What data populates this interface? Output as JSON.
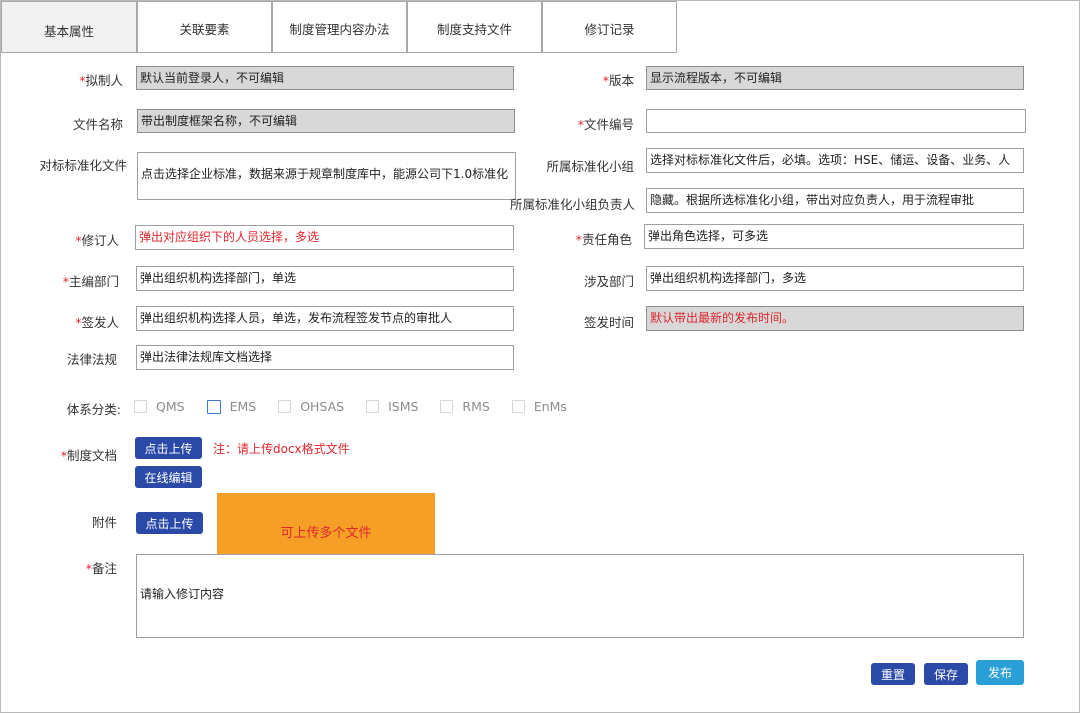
{
  "tabs": [
    {
      "label": "基本属性",
      "active": true
    },
    {
      "label": "关联要素"
    },
    {
      "label": "制度管理内容办法"
    },
    {
      "label": "制度支持文件"
    },
    {
      "label": "修订记录"
    }
  ],
  "required_mark": "*",
  "fields": {
    "drafter": {
      "label": "拟制人",
      "value": "默认当前登录人，不可编辑"
    },
    "version": {
      "label": "版本",
      "value": "显示流程版本，不可编辑"
    },
    "file_name": {
      "label": "文件名称",
      "value": "带出制度框架名称，不可编辑"
    },
    "file_number": {
      "label": "文件编号",
      "value": ""
    },
    "benchmark_file": {
      "label": "对标标准化文件",
      "value": "点击选择企业标准，数据来源于规章制度库中，能源公司下1.0标准化"
    },
    "std_group": {
      "label": "所属标准化小组",
      "value": "选择对标标准化文件后，必填。选项：HSE、储运、设备、业务、人"
    },
    "std_group_owner": {
      "label": "所属标准化小组负责人",
      "value": "隐藏。根据所选标准化小组，带出对应负责人，用于流程审批"
    },
    "reviser": {
      "label": "修订人",
      "value": "弹出对应组织下的人员选择，多选"
    },
    "resp_role": {
      "label": "责任角色",
      "value": "弹出角色选择，可多选"
    },
    "main_dept": {
      "label": "主编部门",
      "value": "弹出组织机构选择部门，单选"
    },
    "related_dept": {
      "label": "涉及部门",
      "value": "弹出组织机构选择部门，多选"
    },
    "issuer": {
      "label": "签发人",
      "value": "弹出组织机构选择人员，单选，发布流程签发节点的审批人"
    },
    "issue_time": {
      "label": "签发时间",
      "value": "默认带出最新的发布时间。"
    },
    "law": {
      "label": "法律法规",
      "value": "弹出法律法规库文档选择"
    }
  },
  "system": {
    "label": "体系分类:",
    "options": [
      {
        "label": "QMS",
        "checked": false
      },
      {
        "label": "EMS",
        "checked": false
      },
      {
        "label": "OHSAS",
        "checked": false
      },
      {
        "label": "ISMS",
        "checked": false
      },
      {
        "label": "RMS",
        "checked": false
      },
      {
        "label": "EnMs",
        "checked": false
      }
    ]
  },
  "doc": {
    "label": "制度文档",
    "upload_label": "点击上传",
    "note": "注：请上传docx格式文件",
    "edit_label": "在线编辑"
  },
  "attachment": {
    "label": "附件",
    "upload_label": "点击上传",
    "hint": "可上传多个文件"
  },
  "remark": {
    "label": "备注",
    "placeholder": "请输入修订内容"
  },
  "footer": {
    "reset_label": "重置",
    "save_label": "保存",
    "publish_label": "发布"
  },
  "colors": {
    "required": "#e0262e",
    "primary_button": "#2b4aa8",
    "publish_button": "#2a9fd6",
    "readonly_bg": "#d8d8d8",
    "hint_box": "#f59f27"
  }
}
